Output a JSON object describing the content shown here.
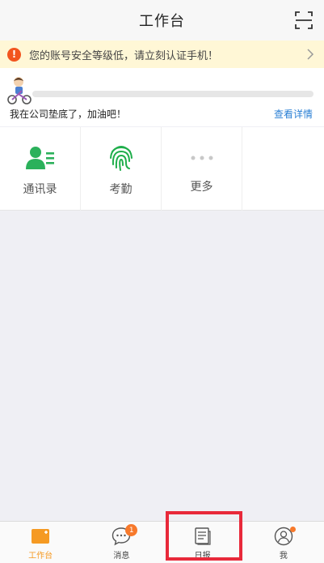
{
  "header": {
    "title": "工作台",
    "scan_icon": "scan-icon"
  },
  "warning": {
    "icon_glyph": "!",
    "text": "您的账号安全等级低，请立刻认证手机！"
  },
  "progress": {
    "fraction": 0,
    "message": "我在公司垫底了，加油吧！",
    "link_label": "查看详情"
  },
  "apps": [
    {
      "label": "通讯录",
      "icon": "contacts-icon"
    },
    {
      "label": "考勤",
      "icon": "fingerprint-icon"
    },
    {
      "label": "更多",
      "icon": "more-dots-icon"
    }
  ],
  "tabs": [
    {
      "label": "工作台",
      "icon": "workbench-icon",
      "active": true
    },
    {
      "label": "消息",
      "icon": "message-icon",
      "badge": "1"
    },
    {
      "label": "日报",
      "icon": "daily-report-icon"
    },
    {
      "label": "我",
      "icon": "profile-icon",
      "dot": true
    }
  ],
  "colors": {
    "accent": "#f59a23",
    "contacts_green": "#2bb15b",
    "fingerprint_green": "#1fae4b",
    "warn_bg": "#fff7d6",
    "warn_icon": "#f2551f",
    "link": "#2a7fd4",
    "highlight": "#e8293a",
    "badge": "#f7792b"
  }
}
